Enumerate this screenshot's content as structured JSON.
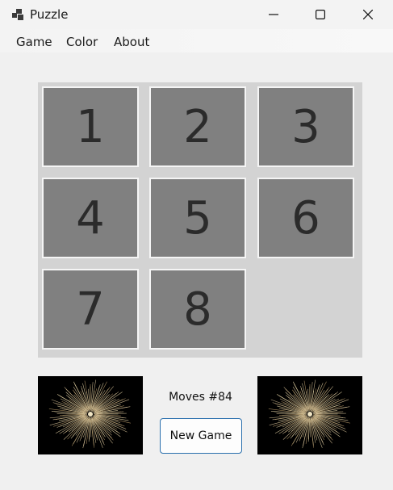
{
  "window": {
    "title": "Puzzle"
  },
  "menu": {
    "game": "Game",
    "color": "Color",
    "about": "About"
  },
  "board": {
    "tiles": [
      {
        "label": "1",
        "row": 0,
        "col": 0
      },
      {
        "label": "2",
        "row": 0,
        "col": 1
      },
      {
        "label": "3",
        "row": 0,
        "col": 2
      },
      {
        "label": "4",
        "row": 1,
        "col": 0
      },
      {
        "label": "5",
        "row": 1,
        "col": 1
      },
      {
        "label": "6",
        "row": 1,
        "col": 2
      },
      {
        "label": "7",
        "row": 2,
        "col": 0
      },
      {
        "label": "8",
        "row": 2,
        "col": 1
      }
    ],
    "empty": {
      "row": 2,
      "col": 2
    }
  },
  "footer": {
    "moves": "Moves #84",
    "new_game": "New Game"
  },
  "colors": {
    "tile": "#808080",
    "board": "#d3d3d3",
    "button_border": "#2a6fad"
  },
  "icons": [
    "app-icon",
    "minimize-icon",
    "maximize-icon",
    "close-icon",
    "fireworks-image"
  ]
}
